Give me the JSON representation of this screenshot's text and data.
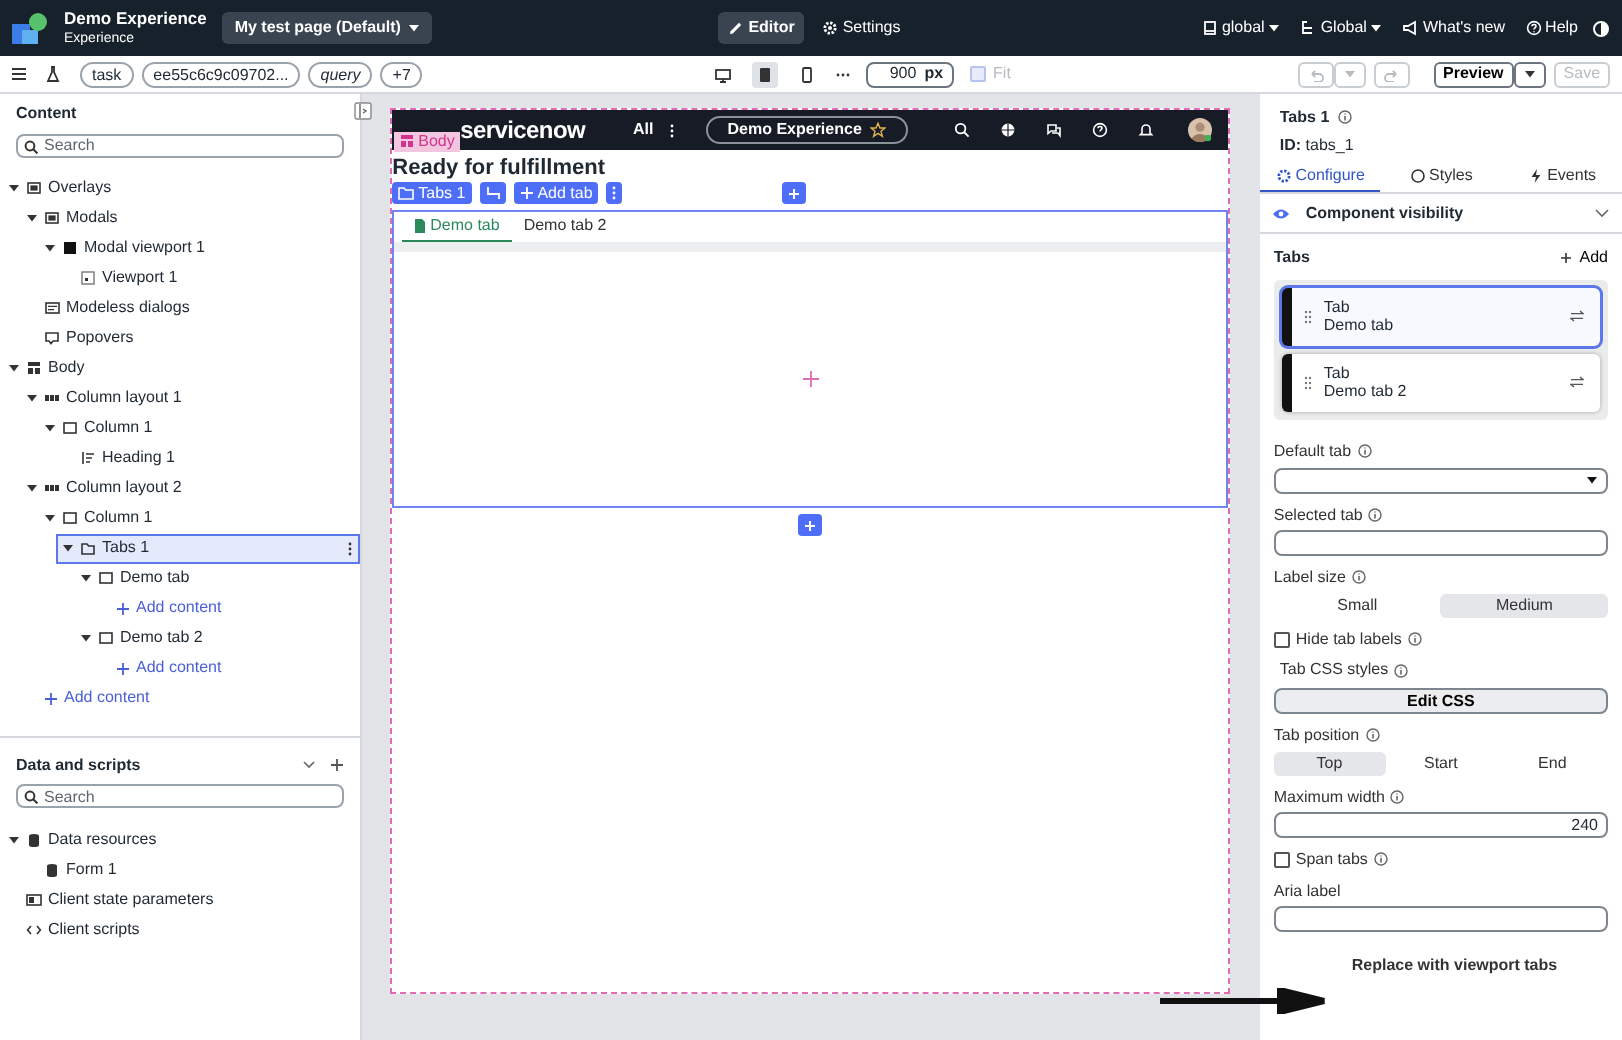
{
  "top_bar": {
    "app_title": "Demo Experience",
    "app_subtitle": "Experience",
    "page_menu": "My test page (Default)",
    "modes": [
      {
        "label": "Editor",
        "selected": true,
        "kind": "edit"
      },
      {
        "label": "Settings",
        "selected": false,
        "kind": "settings"
      }
    ],
    "menus": [
      {
        "label": "global",
        "kind": "file"
      },
      {
        "label": "Global",
        "kind": "tree"
      }
    ],
    "links": [
      {
        "label": "What's new",
        "kind": "news"
      },
      {
        "label": "Help",
        "kind": "help"
      }
    ]
  },
  "toolbar": {
    "chips": [
      {
        "label": "task",
        "italic": false
      },
      {
        "label": "ee55c6c9c09702...",
        "italic": false
      },
      {
        "label": "query",
        "italic": true
      },
      {
        "label": "+7",
        "italic": false
      }
    ],
    "devices": [
      {
        "kind": "desktop",
        "selected": false
      },
      {
        "kind": "tablet",
        "selected": true
      },
      {
        "kind": "phone",
        "selected": false
      }
    ],
    "width_value": "900",
    "width_unit": "px",
    "fit": {
      "label": "Fit",
      "checked": false,
      "disabled": true
    },
    "preview": "Preview",
    "save": {
      "label": "Save",
      "disabled": true
    }
  },
  "content": {
    "title": "Content",
    "search": {
      "placeholder": "Search"
    },
    "tree": [
      {
        "label": "Overlays",
        "kind": "container",
        "expanded": true,
        "selected": false,
        "children": [
          {
            "label": "Modals",
            "kind": "container",
            "expanded": true,
            "selected": false,
            "children": [
              {
                "label": "Modal viewport 1",
                "kind": "dark",
                "expanded": true,
                "selected": false,
                "children": [
                  {
                    "label": "Viewport 1",
                    "kind": "viewport",
                    "selected": false
                  }
                ]
              }
            ]
          },
          {
            "label": "Modeless dialogs",
            "kind": "dialog",
            "selected": false
          },
          {
            "label": "Popovers",
            "kind": "popover",
            "selected": false
          }
        ]
      },
      {
        "label": "Body",
        "kind": "body",
        "expanded": true,
        "selected": false,
        "children": [
          {
            "label": "Column layout 1",
            "kind": "columns",
            "expanded": true,
            "selected": false,
            "children": [
              {
                "label": "Column 1",
                "kind": "column",
                "expanded": true,
                "selected": false,
                "children": [
                  {
                    "label": "Heading 1",
                    "kind": "heading",
                    "selected": false
                  }
                ]
              }
            ]
          },
          {
            "label": "Column layout 2",
            "kind": "columns",
            "expanded": true,
            "selected": false,
            "children": [
              {
                "label": "Column 1",
                "kind": "column",
                "expanded": true,
                "selected": false,
                "children": [
                  {
                    "label": "Tabs 1",
                    "kind": "tabs",
                    "expanded": true,
                    "selected": true,
                    "children": [
                      {
                        "label": "Demo tab",
                        "kind": "column",
                        "expanded": true,
                        "selected": false,
                        "children": [
                          {
                            "label": "Add content",
                            "kind": "add",
                            "selected": false
                          }
                        ]
                      },
                      {
                        "label": "Demo tab 2",
                        "kind": "column",
                        "expanded": true,
                        "selected": false,
                        "children": [
                          {
                            "label": "Add content",
                            "kind": "add",
                            "selected": false
                          }
                        ]
                      }
                    ]
                  }
                ]
              }
            ]
          },
          {
            "label": "Add content",
            "kind": "add",
            "selected": false
          }
        ]
      }
    ]
  },
  "data_scripts": {
    "title": "Data and scripts",
    "search": {
      "placeholder": "Search"
    },
    "tree": [
      {
        "label": "Data resources",
        "kind": "database",
        "expanded": true,
        "selected": false,
        "children": [
          {
            "label": "Form 1",
            "kind": "database",
            "selected": false
          }
        ]
      },
      {
        "label": "Client state parameters",
        "kind": "state",
        "selected": false
      },
      {
        "label": "Client scripts",
        "kind": "code",
        "selected": false
      }
    ]
  },
  "canvas": {
    "body_badge": "Body",
    "logo": "servicenow",
    "nav_all": "All",
    "experience": "Demo Experience",
    "heading": "Ready for fulfillment",
    "component_toolbar": {
      "name": "Tabs 1",
      "add": "Add tab"
    },
    "tabs": [
      {
        "label": "Demo tab",
        "selected": true
      },
      {
        "label": "Demo tab 2",
        "selected": false
      }
    ]
  },
  "properties": {
    "title": "Tabs 1",
    "id_label": "ID:",
    "id_value": "tabs_1",
    "tabs": [
      {
        "label": "Configure",
        "kind": "gear",
        "selected": true
      },
      {
        "label": "Styles",
        "kind": "palette",
        "selected": false
      },
      {
        "label": "Events",
        "kind": "bolt",
        "selected": false
      }
    ],
    "visibility": "Component visibility",
    "tabs_label": "Tabs",
    "add": "Add",
    "tab_items": [
      {
        "type": "Tab",
        "label": "Demo tab",
        "selected": true
      },
      {
        "type": "Tab",
        "label": "Demo tab 2",
        "selected": false
      }
    ],
    "fields": [
      {
        "kind": "select",
        "label": "Default tab",
        "info": true
      },
      {
        "kind": "text",
        "label": "Selected tab",
        "info": true
      },
      {
        "kind": "segmented",
        "label": "Label size",
        "info": true,
        "options": [
          {
            "label": "Small",
            "selected": false
          },
          {
            "label": "Medium",
            "selected": true
          }
        ]
      },
      {
        "kind": "checkbox",
        "label": "Hide tab labels",
        "info": true,
        "checked": false
      },
      {
        "kind": "button",
        "label": "Tab CSS styles",
        "info": true,
        "button": "Edit CSS"
      },
      {
        "kind": "segmented",
        "label": "Tab position",
        "info": true,
        "options": [
          {
            "label": "Top",
            "selected": true
          },
          {
            "label": "Start",
            "selected": false
          },
          {
            "label": "End",
            "selected": false
          }
        ]
      },
      {
        "kind": "text",
        "label": "Maximum width",
        "info": true,
        "value": "240"
      },
      {
        "kind": "checkbox",
        "label": "Span tabs",
        "info": true,
        "checked": false
      },
      {
        "kind": "text",
        "label": "Aria label",
        "info": false
      }
    ],
    "replace_link": "Replace with viewport tabs"
  }
}
